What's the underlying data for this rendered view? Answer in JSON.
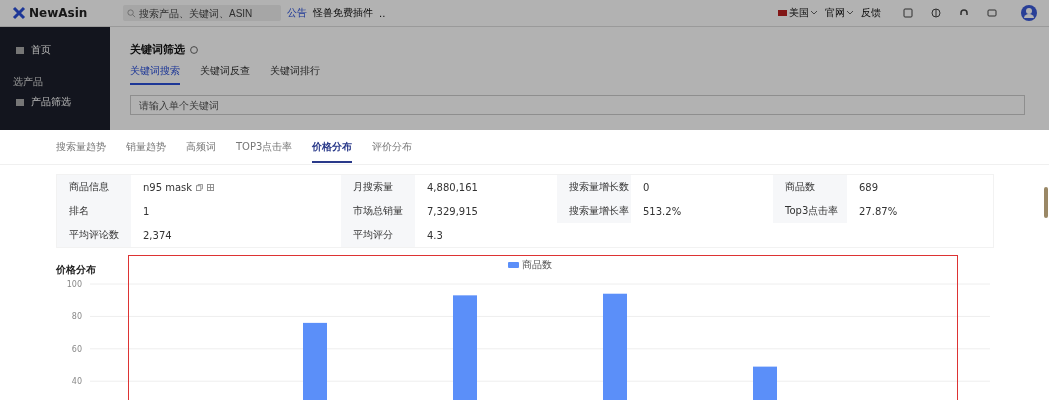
{
  "header": {
    "logo": "NewAsin",
    "search_placeholder": "搜索产品、关键词、ASIN",
    "links": [
      "公告",
      "怪兽免费插件"
    ],
    "more": "..",
    "nav": [
      {
        "label": "美国",
        "dropdown": true
      },
      {
        "label": "官网",
        "dropdown": true
      },
      {
        "label": "反馈",
        "dropdown": false
      }
    ]
  },
  "sidebar": {
    "items": [
      {
        "label": "首页",
        "kind": "item"
      },
      {
        "label": "选产品",
        "kind": "section"
      },
      {
        "label": "产品筛选",
        "kind": "item"
      }
    ]
  },
  "page": {
    "title": "关键词筛选",
    "tabs": [
      {
        "label": "关键词搜索",
        "selected": true
      },
      {
        "label": "关键词反查",
        "selected": false
      },
      {
        "label": "关键词排行",
        "selected": false
      }
    ],
    "search_placeholder": "请输入单个关键词"
  },
  "modal": {
    "tabs": [
      {
        "label": "搜索量趋势",
        "selected": false
      },
      {
        "label": "销量趋势",
        "selected": false
      },
      {
        "label": "高频词",
        "selected": false
      },
      {
        "label": "TOP3点击率",
        "selected": false
      },
      {
        "label": "价格分布",
        "selected": true
      },
      {
        "label": "评价分布",
        "selected": false
      }
    ],
    "info_rows": [
      [
        {
          "label": "商品信息",
          "value": "n95 mask",
          "icons": true
        },
        {
          "label": "月搜索量",
          "value": "4,880,161"
        },
        {
          "label": "搜索量增长数",
          "value": "0"
        },
        {
          "label": "商品数",
          "value": "689"
        }
      ],
      [
        {
          "label": "排名",
          "value": "1"
        },
        {
          "label": "市场总销量",
          "value": "7,329,915"
        },
        {
          "label": "搜索量增长率",
          "value": "513.2%"
        },
        {
          "label": "Top3点击率",
          "value": "27.87%"
        }
      ],
      [
        {
          "label": "平均评论数",
          "value": "2,374"
        },
        {
          "label": "平均评分",
          "value": "4.3"
        }
      ]
    ],
    "chart_title": "价格分布",
    "chart_data": {
      "type": "bar",
      "series": [
        {
          "name": "商品数",
          "color": "#5b8ff9",
          "values": [
            null,
            76,
            93,
            94,
            49,
            null
          ]
        }
      ],
      "yticks": [
        40,
        60,
        80,
        100
      ],
      "ylim": [
        0,
        100
      ],
      "grid": true
    }
  }
}
